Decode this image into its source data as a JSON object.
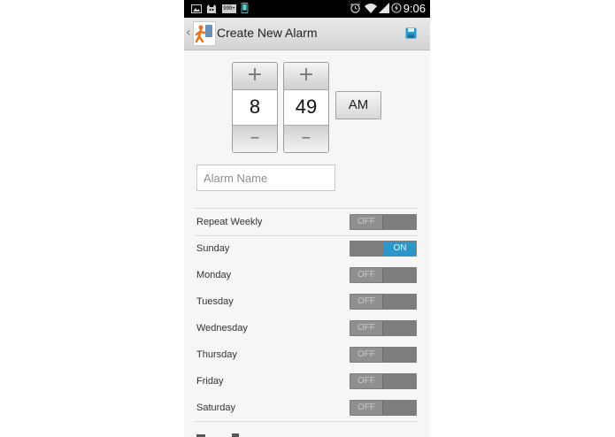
{
  "status_bar": {
    "time": "9:06",
    "notification_icons": [
      "image-icon",
      "cat-icon",
      "999-badge-icon",
      "phone-icon"
    ],
    "status_icons": [
      "alarm-clock-icon",
      "wifi-icon",
      "signal-icon",
      "battery-charging-icon"
    ],
    "badge_text": "999+"
  },
  "action_bar": {
    "title": "Create New Alarm",
    "back_icon": "back-caret-icon",
    "save_icon": "save-floppy-icon",
    "accent": "#2b96c9"
  },
  "time_picker": {
    "hour": "8",
    "minute": "49",
    "ampm": "AM",
    "increment_label": "+",
    "decrement_label": "–"
  },
  "alarm_name": {
    "placeholder": "Alarm Name",
    "value": ""
  },
  "settings": [
    {
      "label": "Repeat Weekly",
      "state": "OFF"
    },
    {
      "label": "Sunday",
      "state": "ON"
    },
    {
      "label": "Monday",
      "state": "OFF"
    },
    {
      "label": "Tuesday",
      "state": "OFF"
    },
    {
      "label": "Wednesday",
      "state": "OFF"
    },
    {
      "label": "Thursday",
      "state": "OFF"
    },
    {
      "label": "Friday",
      "state": "OFF"
    },
    {
      "label": "Saturday",
      "state": "OFF"
    }
  ],
  "colors": {
    "toggle_on": "#2b96c9",
    "toggle_off": "#8f8f8f",
    "status_bar": "#000000",
    "action_bar": "#dedede"
  }
}
